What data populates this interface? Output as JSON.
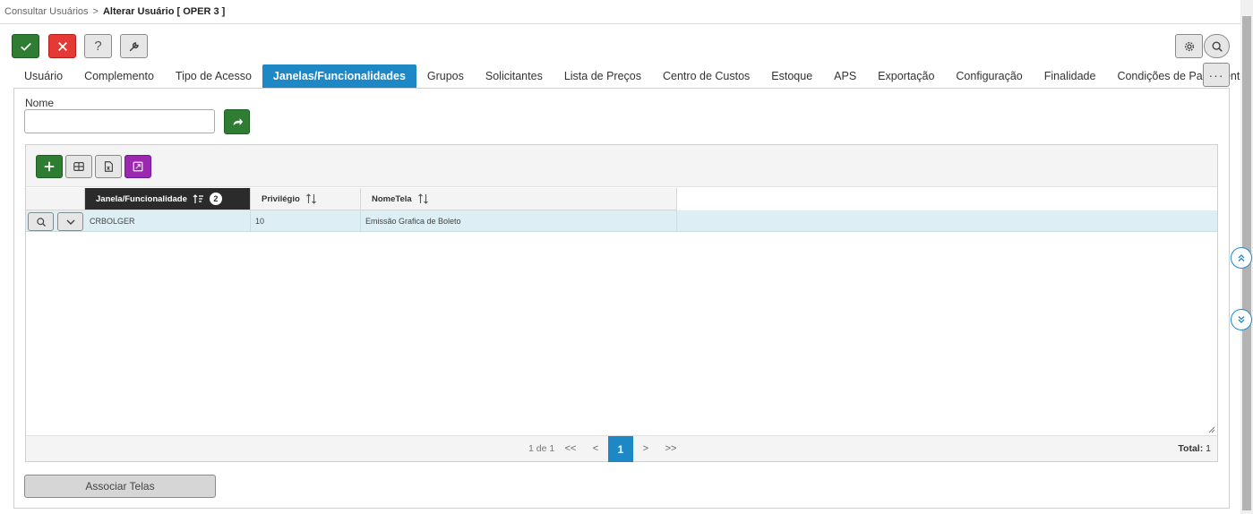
{
  "breadcrumb": {
    "parent": "Consultar Usuários",
    "separator": ">",
    "current": "Alterar Usuário [ OPER 3 ]"
  },
  "toolbar": {
    "help_label": "?"
  },
  "tabs": [
    {
      "label": "Usuário"
    },
    {
      "label": "Complemento"
    },
    {
      "label": "Tipo de Acesso"
    },
    {
      "label": "Janelas/Funcionalidades"
    },
    {
      "label": "Grupos"
    },
    {
      "label": "Solicitantes"
    },
    {
      "label": "Lista de Preços"
    },
    {
      "label": "Centro de Custos"
    },
    {
      "label": "Estoque"
    },
    {
      "label": "APS"
    },
    {
      "label": "Exportação"
    },
    {
      "label": "Configuração"
    },
    {
      "label": "Finalidade"
    },
    {
      "label": "Condições de Pagamento"
    }
  ],
  "active_tab": "Janelas/Funcionalidades",
  "more_label": "···",
  "filter": {
    "nome_label": "Nome",
    "nome_value": ""
  },
  "grid": {
    "columns": [
      {
        "label": "Janela/Funcionalidade",
        "sort_badge": "2"
      },
      {
        "label": "Privilégio"
      },
      {
        "label": "NomeTela"
      }
    ],
    "rows": [
      {
        "janela": "CRBOLGER",
        "privilegio": "10",
        "nome_tela": "Emissão Grafica de Boleto"
      }
    ],
    "pager": {
      "info": "1 de 1",
      "first": "<<",
      "prev": "<",
      "current": "1",
      "next": ">",
      "last": ">>",
      "total_label": "Total:",
      "total_value": "1"
    }
  },
  "associar_button": "Associar Telas",
  "colors": {
    "accent": "#1e88c7",
    "ok": "#2e7d32",
    "cancel": "#e53935",
    "purple": "#9c27b0",
    "row_highlight": "#ddeef4",
    "header_dark": "#2b2b2b"
  }
}
